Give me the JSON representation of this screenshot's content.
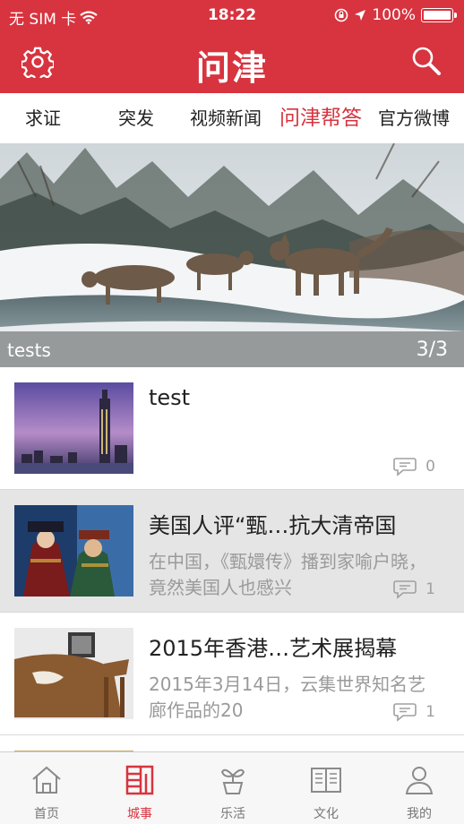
{
  "status_bar": {
    "carrier": "无 SIM 卡",
    "time": "18:22",
    "battery": "100%"
  },
  "nav": {
    "title": "问津",
    "settings_icon": "gear-icon",
    "search_icon": "search-icon"
  },
  "tabs": [
    {
      "label": "求证"
    },
    {
      "label": "突发"
    },
    {
      "label": "视频新闻"
    },
    {
      "label": "问津帮答",
      "active": true
    },
    {
      "label": "官方微博"
    }
  ],
  "banner": {
    "caption": "tests",
    "counter": "3/3"
  },
  "news": [
    {
      "title": "test",
      "desc": "",
      "comments": "0"
    },
    {
      "title": "美国人评“甄…抗大清帝国",
      "desc": "在中国，《甄嬛传》播到家喻户晓，竟然美国人也感兴",
      "comments": "1"
    },
    {
      "title": "2015年香港…艺术展揭幕",
      "desc": "2015年3月14日，云集世界知名艺廊作品的20",
      "comments": "1"
    }
  ],
  "bottom_tabs": [
    {
      "label": "首页",
      "icon": "home-icon"
    },
    {
      "label": "城事",
      "icon": "city-icon",
      "active": true
    },
    {
      "label": "乐活",
      "icon": "plant-icon"
    },
    {
      "label": "文化",
      "icon": "book-icon"
    },
    {
      "label": "我的",
      "icon": "user-icon"
    }
  ],
  "colors": {
    "brand": "#d7343f",
    "muted": "#9a9a9a"
  }
}
